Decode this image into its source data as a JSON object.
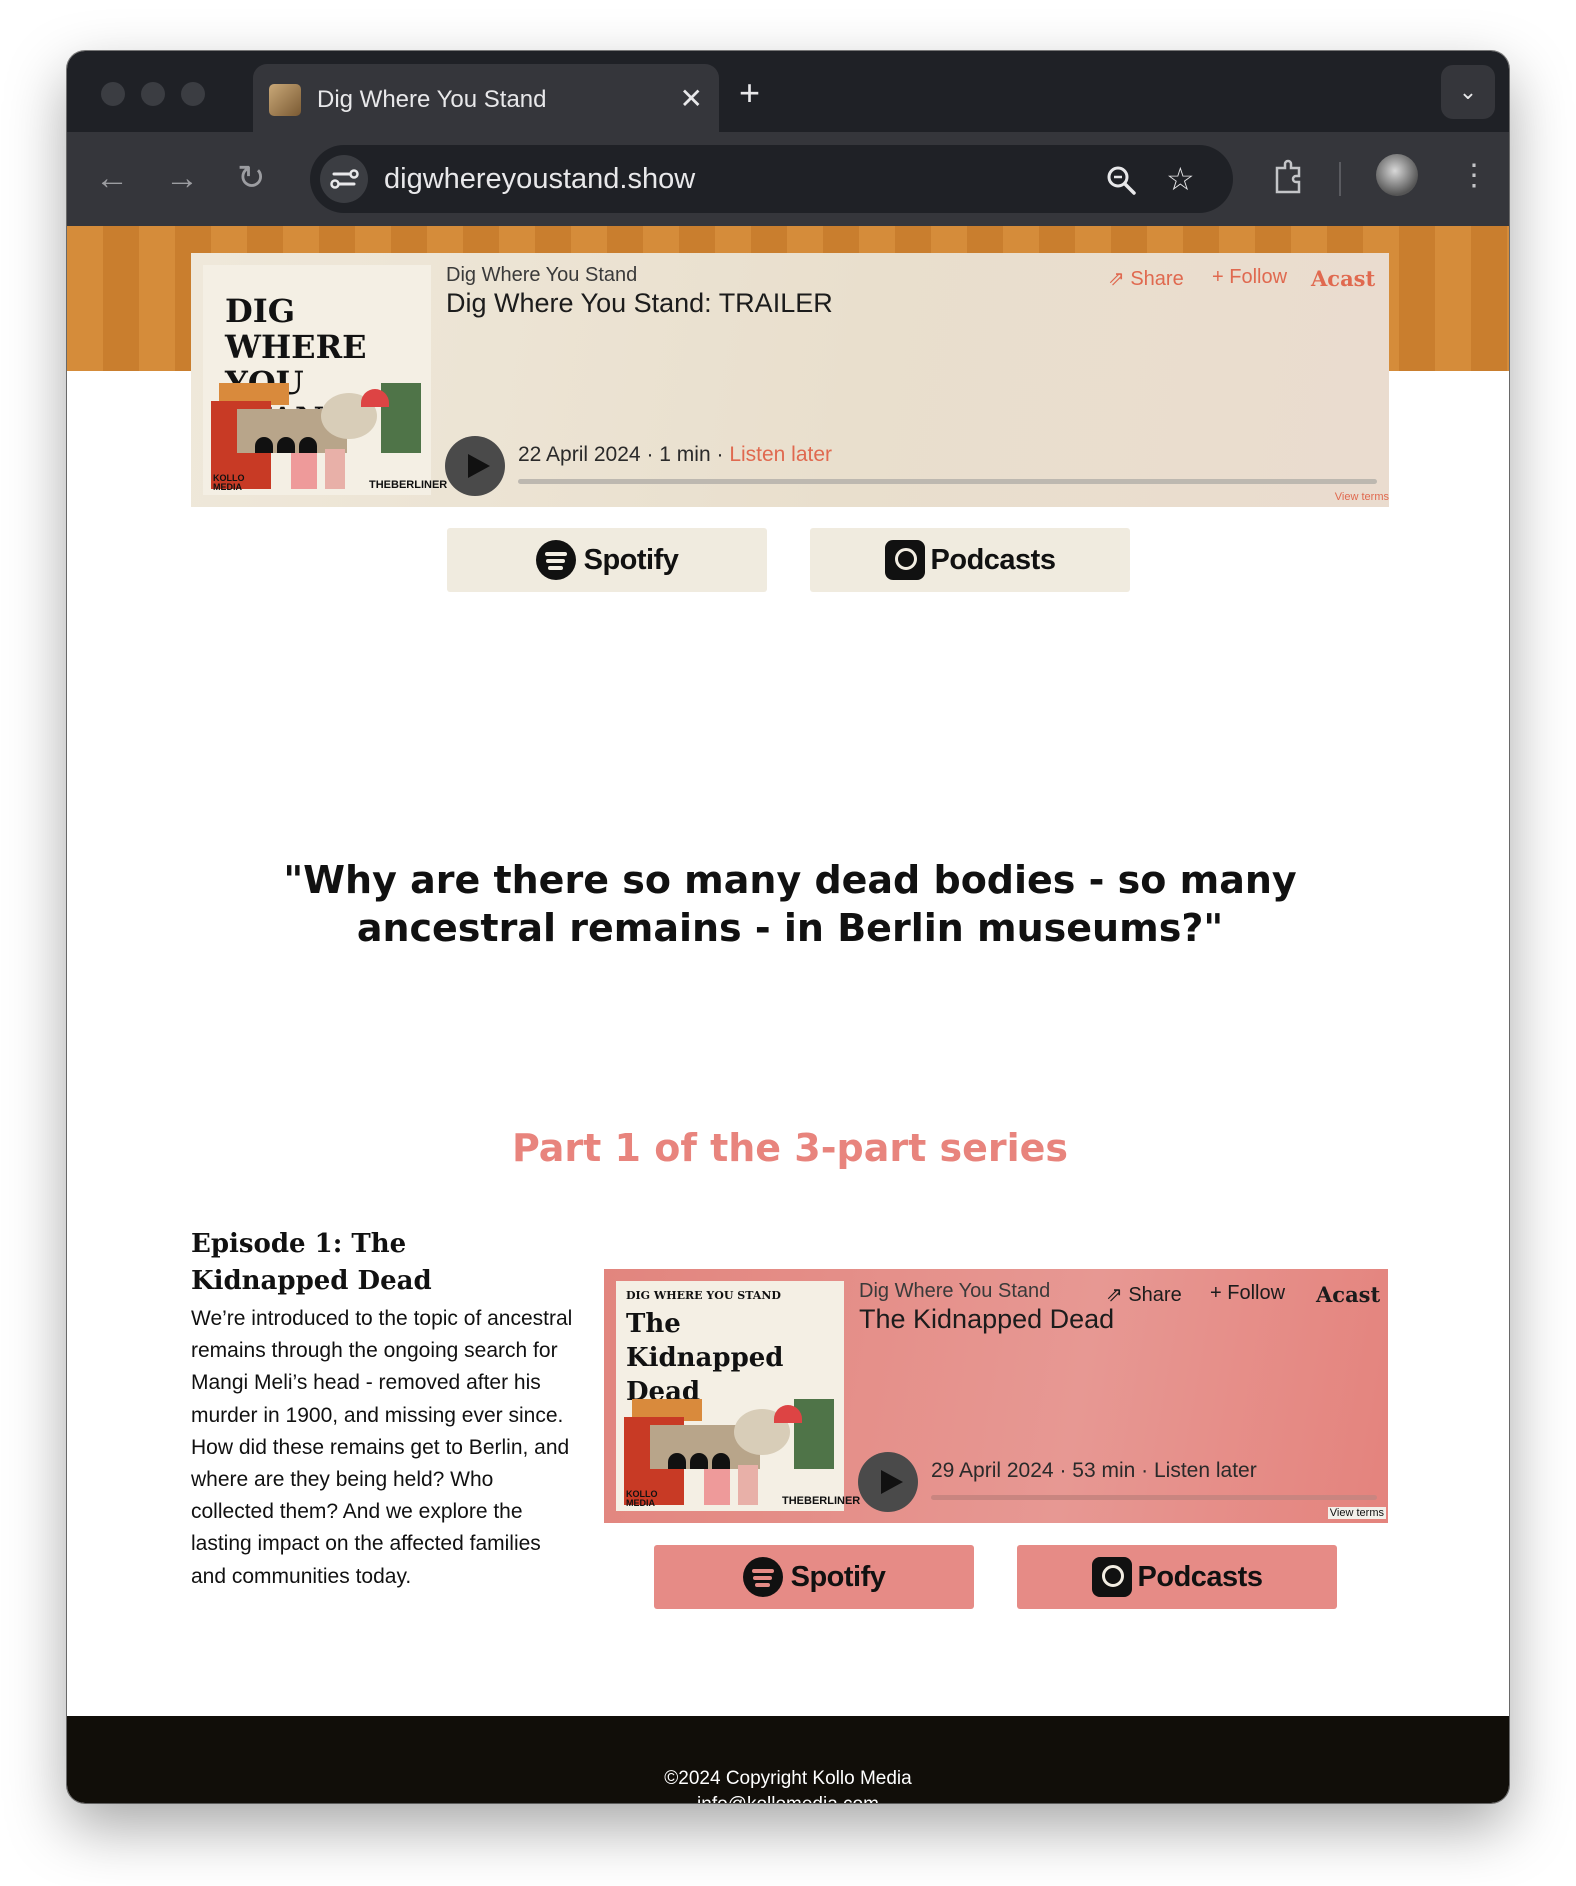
{
  "browser": {
    "tab_title": "Dig Where You Stand",
    "tab_close": "✕",
    "new_tab": "+",
    "url": "digwhereyoustand.show",
    "icons": [
      "back-icon",
      "forward-icon",
      "reload-icon",
      "site-info-icon",
      "zoom-icon",
      "bookmark-star-icon",
      "extensions-icon",
      "profile-avatar",
      "more-menu-icon",
      "tab-search-icon"
    ]
  },
  "trailer_player": {
    "cover_title": "DIG WHERE YOU STAND",
    "cover_brand_left": "KOLLO MEDIA",
    "cover_brand_right": "THEBERLINER",
    "show_name": "Dig Where You Stand",
    "episode_title": "Dig Where You Stand: TRAILER",
    "share_label": "Share",
    "follow_label": "Follow",
    "brand": "Acast",
    "date": "22 April 2024",
    "duration": "1 min",
    "listen_later": "Listen later",
    "progress": 0,
    "view_terms": "View terms",
    "accent_color": "#e0694f"
  },
  "trailer_links": {
    "spotify_label": "Spotify",
    "podcasts_label": "Podcasts"
  },
  "quote": "\"Why are there so many dead bodies - so many ancestral remains - in Berlin museums?\"",
  "series_heading": "Part 1 of the 3-part series",
  "episode": {
    "title": "Episode 1: The Kidnapped Dead",
    "description": "We’re introduced to the topic of ancestral remains through the ongoing search for Mangi Meli’s head - removed after his murder in 1900, and missing ever since. How did these remains get to Berlin, and where are they being held? Who collected them? And we explore the lasting impact on the affected families and communities today."
  },
  "episode_player": {
    "cover_subtitle": "DIG WHERE YOU STAND",
    "cover_title": "The Kidnapped Dead",
    "cover_brand_left": "KOLLO MEDIA",
    "cover_brand_right": "THEBERLINER",
    "show_name": "Dig Where You Stand",
    "episode_title": "The Kidnapped Dead",
    "share_label": "Share",
    "follow_label": "Follow",
    "brand": "Acast",
    "date": "29 April 2024",
    "duration": "53 min",
    "listen_later": "Listen later",
    "progress": 0,
    "view_terms": "View terms"
  },
  "episode_links": {
    "spotify_label": "Spotify",
    "podcasts_label": "Podcasts"
  },
  "footer": {
    "copyright": "©2024 Copyright Kollo Media",
    "email": "info@kollomedia.com"
  },
  "colors": {
    "banner": "#d58c3a",
    "accent_pink": "#e8847d",
    "button_cream": "#f0ebdf",
    "button_pink": "#e68b86",
    "footer_bg": "#110e09"
  }
}
